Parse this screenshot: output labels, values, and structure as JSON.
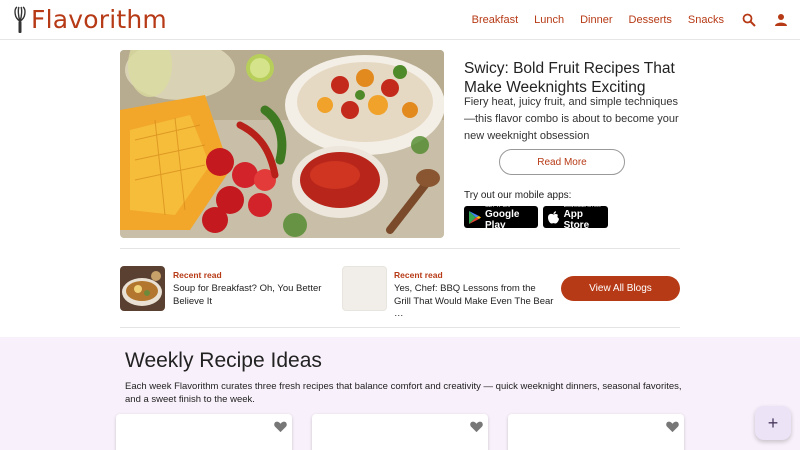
{
  "brand": {
    "name": "Flavorithm",
    "color": "#b73a16"
  },
  "nav": {
    "links": [
      "Breakfast",
      "Lunch",
      "Dinner",
      "Desserts",
      "Snacks"
    ],
    "icons": [
      "search-icon",
      "user-icon"
    ]
  },
  "hero": {
    "title": "Swicy: Bold Fruit Recipes That Make Weeknights Exciting",
    "description": "Fiery heat, juicy fruit, and simple techniques—this flavor combo is about to become your new weeknight obsession",
    "read_more": "Read More",
    "apps_label": "Try out our mobile apps:",
    "google_play": {
      "small": "GET IT ON",
      "big": "Google Play"
    },
    "app_store": {
      "small": "Download on the",
      "big": "App Store"
    }
  },
  "recent": {
    "items": [
      {
        "label": "Recent read",
        "title": "Soup for Breakfast? Oh, You Better Believe It"
      },
      {
        "label": "Recent read",
        "title": "Yes, Chef: BBQ Lessons from the Grill That Would Make Even The Bear …"
      }
    ],
    "view_all": "View All Blogs"
  },
  "weekly": {
    "title": "Weekly Recipe Ideas",
    "description": "Each week Flavorithm curates three fresh recipes that balance comfort and creativity — quick weeknight dinners, seasonal favorites, and a sweet finish to the week.",
    "background": "#f8f0fa"
  },
  "fab": {
    "label": "+"
  }
}
